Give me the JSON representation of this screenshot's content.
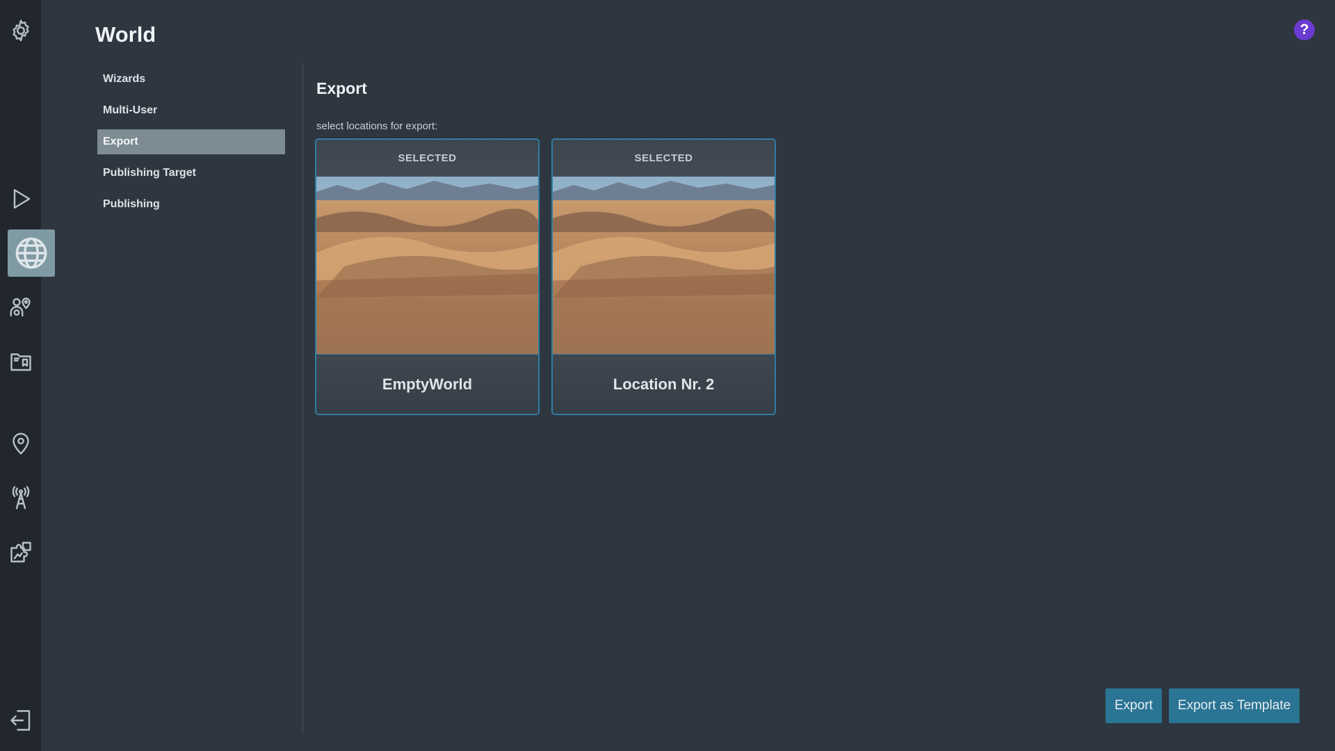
{
  "header": {
    "title": "World",
    "help_label": "?"
  },
  "rail": {
    "items": [
      {
        "name": "settings",
        "icon": "gear-icon"
      },
      {
        "name": "play",
        "icon": "play-icon"
      },
      {
        "name": "world",
        "icon": "globe-icon",
        "active": true
      },
      {
        "name": "characters",
        "icon": "people-location-icon"
      },
      {
        "name": "media",
        "icon": "folder-image-icon"
      },
      {
        "name": "locations",
        "icon": "map-pin-icon"
      },
      {
        "name": "broadcast",
        "icon": "antenna-icon"
      },
      {
        "name": "plugins",
        "icon": "puzzle-icon"
      },
      {
        "name": "logout",
        "icon": "logout-icon"
      }
    ]
  },
  "subnav": {
    "items": [
      {
        "label": "Wizards"
      },
      {
        "label": "Multi-User"
      },
      {
        "label": "Export",
        "active": true
      },
      {
        "label": "Publishing Target"
      },
      {
        "label": "Publishing"
      }
    ]
  },
  "main": {
    "title": "Export",
    "hint": "select locations for export:",
    "cards": [
      {
        "badge": "SELECTED",
        "label": "EmptyWorld"
      },
      {
        "badge": "SELECTED",
        "label": "Location Nr. 2"
      }
    ]
  },
  "actions": {
    "export_label": "Export",
    "export_template_label": "Export as Template"
  },
  "colors": {
    "background": "#2e3640",
    "rail": "#22272d",
    "accent": "#2f7fa3",
    "button": "#2a7494",
    "help": "#6a3bd0"
  }
}
